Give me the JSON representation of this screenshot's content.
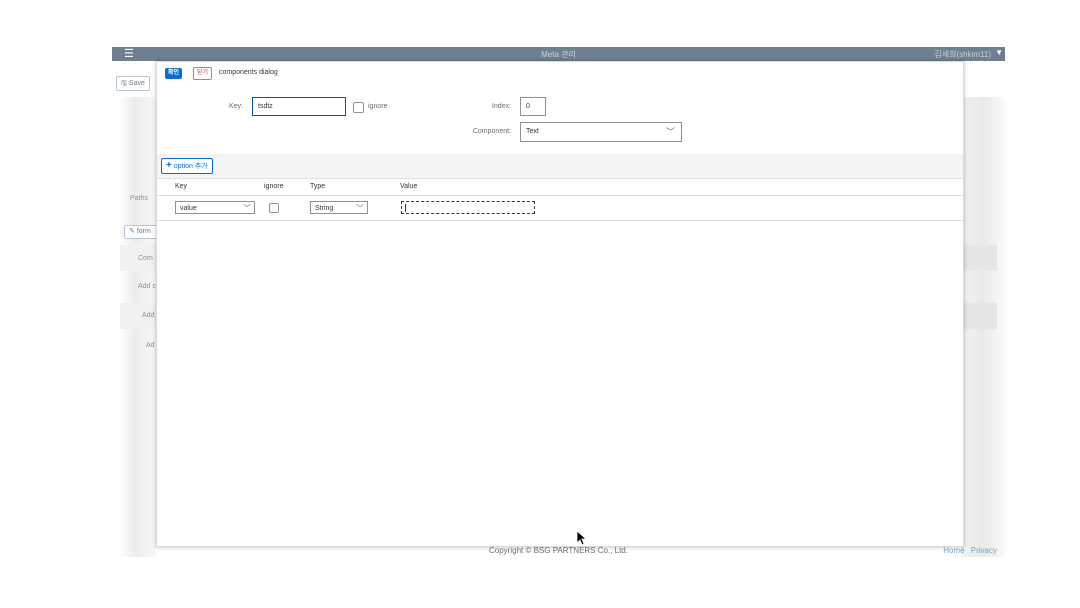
{
  "shell": {
    "menu_icon": "hamburger-icon",
    "title": "Meta 관리",
    "user": "김세희(shkim11)"
  },
  "background": {
    "save_label": "Save",
    "paths_label": "Paths",
    "form_button": "form",
    "rows": [
      "Com",
      "Add c",
      "Add",
      "Ad"
    ]
  },
  "footer": {
    "copyright": "Copyright © BSG PARTNERS Co., Ltd.",
    "links": [
      "Home",
      "Privacy"
    ]
  },
  "dialog": {
    "ok_label": "확인",
    "close_label": "닫기",
    "title": "components dialog",
    "key_label": "Key:",
    "key_value": "tsdtz",
    "ignore_label": "ignore",
    "index_label": "Index:",
    "index_value": "0",
    "component_label": "Component:",
    "component_value": "Text",
    "add_option_label": "option 추가",
    "columns": [
      "Key",
      "ignore",
      "Type",
      "Value"
    ],
    "rows": [
      {
        "key": "value",
        "ignore": false,
        "type": "String",
        "value": ""
      }
    ]
  },
  "colors": {
    "shell_bg": "#6f7f8f",
    "accent": "#0a6ed1",
    "close_red": "#cc3333"
  }
}
